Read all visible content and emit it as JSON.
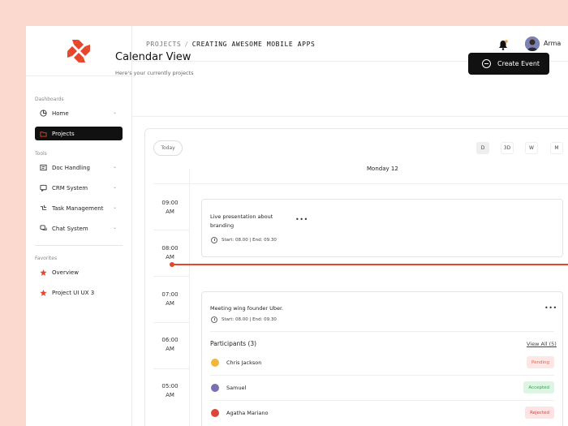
{
  "sidebar": {
    "sections": {
      "dashboards": "Dashboards",
      "tools": "Tools",
      "favorites": "Favorites"
    },
    "items": [
      {
        "label": "Home",
        "icon": "pie-chart-icon"
      },
      {
        "label": "Projects",
        "icon": "folder-icon"
      },
      {
        "label": "Doc Handling",
        "icon": "document-icon"
      },
      {
        "label": "CRM System",
        "icon": "chat-bubble-icon"
      },
      {
        "label": "Task Management",
        "icon": "workflow-icon"
      },
      {
        "label": "Chat System",
        "icon": "chat-icon"
      }
    ],
    "favorites": [
      {
        "label": "Overview",
        "icon": "star-icon"
      },
      {
        "label": "Project UI UX 3",
        "icon": "star-icon"
      }
    ]
  },
  "header": {
    "crumb_root": "PROJECTS",
    "crumb_sep": "/",
    "crumb_current": "CREATING AWESOME MOBILE APPS",
    "user_name": "Arma"
  },
  "page": {
    "title": "Calendar View",
    "subtitle": "Here's your currently projects",
    "create_button": "Create Event"
  },
  "calendar": {
    "today_label": "Today",
    "views": [
      "D",
      "3D",
      "W",
      "M"
    ],
    "active_view": "D",
    "day_label": "Monday 12",
    "times": [
      {
        "hour": "09:00",
        "period": "AM"
      },
      {
        "hour": "08:00",
        "period": "AM"
      },
      {
        "hour": "07:00",
        "period": "AM"
      },
      {
        "hour": "06:00",
        "period": "AM"
      },
      {
        "hour": "05:00",
        "period": "AM"
      }
    ],
    "events": [
      {
        "title_line1": "Live presentation about",
        "title_line2": "branding",
        "time_range": "Start: 08.00 | End: 09.30",
        "more": "•••"
      },
      {
        "title_line1": "Meeting wing founder Uber.",
        "time_range": "Start: 08.00 | End: 09.30",
        "more": "•••",
        "participants_title": "Participants (3)",
        "view_all": "View All (5)",
        "participants": [
          {
            "name": "Chris Jackson",
            "status": "Pending"
          },
          {
            "name": "Samuel",
            "status": "Accepted"
          },
          {
            "name": "Agatha Mariano",
            "status": "Rejected"
          }
        ]
      }
    ]
  },
  "colors": {
    "accent": "#e8462a",
    "background": "#fbd9cf",
    "dark": "#111111"
  }
}
